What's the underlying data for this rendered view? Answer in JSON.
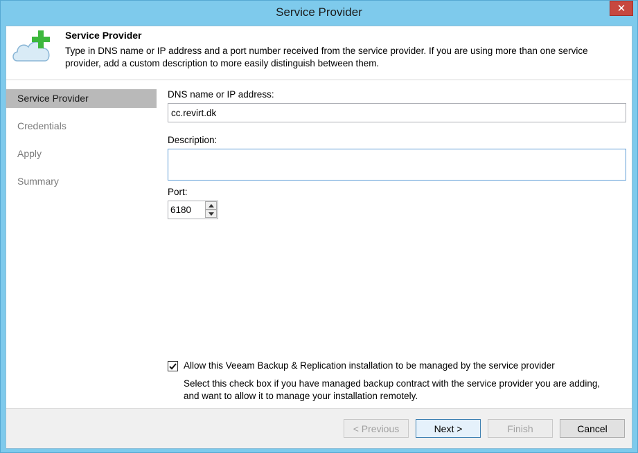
{
  "window": {
    "title": "Service Provider",
    "close_glyph": "✕"
  },
  "header": {
    "title": "Service Provider",
    "description": "Type in DNS name or IP address and a port number received from the service provider. If you are using more than one service provider, add a custom description to more easily distinguish between them.",
    "icon": "cloud-add-icon"
  },
  "steps": [
    {
      "label": "Service Provider",
      "active": true
    },
    {
      "label": "Credentials",
      "active": false
    },
    {
      "label": "Apply",
      "active": false
    },
    {
      "label": "Summary",
      "active": false
    }
  ],
  "form": {
    "dns_label": "DNS name or IP address:",
    "dns_value": "cc.revirt.dk",
    "description_label": "Description:",
    "description_value": "",
    "port_label": "Port:",
    "port_value": "6180",
    "manage_checked": true,
    "manage_label": "Allow this Veeam Backup & Replication installation to be managed by the service provider",
    "manage_help": "Select this check box if you have managed backup contract with the service provider you are adding, and want to allow it to manage your installation remotely."
  },
  "buttons": {
    "previous": "< Previous",
    "next": "Next >",
    "finish": "Finish",
    "cancel": "Cancel"
  },
  "colors": {
    "title_bar": "#7ecaec",
    "close_button": "#c7483f",
    "selected_step": "#b9b9b9",
    "plus_green": "#3db83d"
  }
}
